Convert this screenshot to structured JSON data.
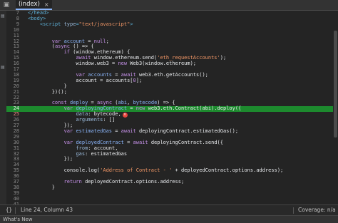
{
  "tab": {
    "label": "(index)",
    "close": "×"
  },
  "toolbar": {
    "left_icon": "▣"
  },
  "editor": {
    "lines": [
      {
        "n": "7",
        "segs": [
          {
            "t": "</head>",
            "c": "tag"
          }
        ]
      },
      {
        "n": "8",
        "segs": [
          {
            "t": "<body>",
            "c": "tag"
          }
        ]
      },
      {
        "n": "9",
        "segs": [
          {
            "t": "    "
          },
          {
            "t": "<script ",
            "c": "tag"
          },
          {
            "t": "type",
            "c": "attr"
          },
          {
            "t": "=",
            "c": "tag"
          },
          {
            "t": "\"text/javascript\"",
            "c": "str"
          },
          {
            "t": ">",
            "c": "tag"
          }
        ]
      },
      {
        "n": "10",
        "segs": []
      },
      {
        "n": "11",
        "segs": []
      },
      {
        "n": "12",
        "segs": [
          {
            "t": "        "
          },
          {
            "t": "var ",
            "c": "kw"
          },
          {
            "t": "account",
            "c": "def"
          },
          {
            "t": " = "
          },
          {
            "t": "null",
            "c": "kw"
          },
          {
            "t": ";"
          }
        ]
      },
      {
        "n": "13",
        "segs": [
          {
            "t": "        ("
          },
          {
            "t": "async",
            "c": "kw"
          },
          {
            "t": " () => {"
          }
        ]
      },
      {
        "n": "14",
        "segs": [
          {
            "t": "            "
          },
          {
            "t": "if",
            "c": "kw"
          },
          {
            "t": " (window.ethereum) {"
          }
        ]
      },
      {
        "n": "15",
        "segs": [
          {
            "t": "                "
          },
          {
            "t": "await",
            "c": "kw"
          },
          {
            "t": " window.ethereum.send("
          },
          {
            "t": "'eth_requestAccounts'",
            "c": "str"
          },
          {
            "t": ");"
          }
        ]
      },
      {
        "n": "16",
        "segs": [
          {
            "t": "                window.web3 = "
          },
          {
            "t": "new",
            "c": "kw"
          },
          {
            "t": " Web3(window.ethereum);"
          }
        ]
      },
      {
        "n": "17",
        "segs": []
      },
      {
        "n": "18",
        "segs": [
          {
            "t": "                "
          },
          {
            "t": "var ",
            "c": "kw"
          },
          {
            "t": "accounts",
            "c": "def"
          },
          {
            "t": " = "
          },
          {
            "t": "await",
            "c": "kw"
          },
          {
            "t": " web3.eth.getAccounts();"
          }
        ]
      },
      {
        "n": "19",
        "segs": [
          {
            "t": "                account = accounts["
          },
          {
            "t": "0",
            "c": "kw"
          },
          {
            "t": "];"
          }
        ]
      },
      {
        "n": "20",
        "segs": [
          {
            "t": "            }"
          }
        ]
      },
      {
        "n": "21",
        "segs": [
          {
            "t": "        })();"
          }
        ]
      },
      {
        "n": "22",
        "segs": []
      },
      {
        "n": "23",
        "segs": [
          {
            "t": "        "
          },
          {
            "t": "const ",
            "c": "kw"
          },
          {
            "t": "deploy",
            "c": "def"
          },
          {
            "t": " = "
          },
          {
            "t": "async",
            "c": "kw"
          },
          {
            "t": " ("
          },
          {
            "t": "abi",
            "c": "def"
          },
          {
            "t": ", "
          },
          {
            "t": "bytecode",
            "c": "def"
          },
          {
            "t": ") => {"
          }
        ]
      },
      {
        "n": "24",
        "hl": true,
        "segs": [
          {
            "t": "            "
          },
          {
            "t": "var ",
            "c": "kw"
          },
          {
            "t": "deployingContract",
            "c": "def"
          },
          {
            "t": " = "
          },
          {
            "t": "new",
            "c": "kw"
          },
          {
            "t": " web3.eth.Contract(abi).deploy({"
          }
        ]
      },
      {
        "n": "25",
        "err": true,
        "badge": "×",
        "segs": [
          {
            "t": "                "
          },
          {
            "t": "data",
            "c": "prop"
          },
          {
            "t": ": bytecode,"
          }
        ]
      },
      {
        "n": "26",
        "segs": [
          {
            "t": "                "
          },
          {
            "t": "arguments",
            "c": "prop"
          },
          {
            "t": ": []"
          }
        ]
      },
      {
        "n": "27",
        "segs": [
          {
            "t": "            });"
          }
        ]
      },
      {
        "n": "28",
        "segs": [
          {
            "t": "            "
          },
          {
            "t": "var ",
            "c": "kw"
          },
          {
            "t": "estimatedGas",
            "c": "def"
          },
          {
            "t": " = "
          },
          {
            "t": "await",
            "c": "kw"
          },
          {
            "t": " deployingContract.estimatedGas();"
          }
        ]
      },
      {
        "n": "29",
        "segs": []
      },
      {
        "n": "30",
        "segs": [
          {
            "t": "            "
          },
          {
            "t": "var ",
            "c": "kw"
          },
          {
            "t": "deployedContract",
            "c": "def"
          },
          {
            "t": " = "
          },
          {
            "t": "await",
            "c": "kw"
          },
          {
            "t": " deployingContract.send({"
          }
        ]
      },
      {
        "n": "31",
        "segs": [
          {
            "t": "                "
          },
          {
            "t": "from",
            "c": "prop"
          },
          {
            "t": ": account,"
          }
        ]
      },
      {
        "n": "32",
        "segs": [
          {
            "t": "                "
          },
          {
            "t": "gas",
            "c": "prop"
          },
          {
            "t": ": estimatedGas"
          }
        ]
      },
      {
        "n": "33",
        "segs": [
          {
            "t": "            });"
          }
        ]
      },
      {
        "n": "34",
        "segs": []
      },
      {
        "n": "35",
        "segs": [
          {
            "t": "            console.log("
          },
          {
            "t": "'Address of Contract - '",
            "c": "str"
          },
          {
            "t": " + deployedContract.options.address);"
          }
        ]
      },
      {
        "n": "36",
        "segs": []
      },
      {
        "n": "37",
        "segs": [
          {
            "t": "            "
          },
          {
            "t": "return",
            "c": "kw"
          },
          {
            "t": " deployedContract.options.address;"
          }
        ]
      },
      {
        "n": "38",
        "segs": [
          {
            "t": "        }"
          }
        ]
      },
      {
        "n": "39",
        "segs": []
      },
      {
        "n": "40",
        "segs": []
      },
      {
        "n": "41",
        "segs": []
      }
    ]
  },
  "statusbar": {
    "braces": "{}",
    "position": "Line 24, Column 43",
    "coverage": "Coverage: n/a"
  },
  "drawer": {
    "label": "What's New"
  }
}
